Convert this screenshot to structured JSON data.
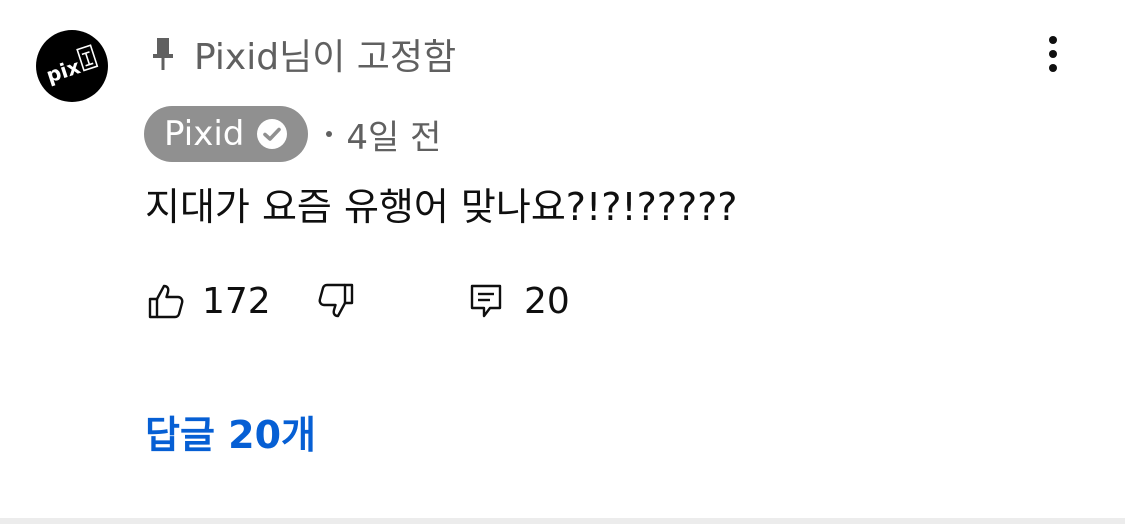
{
  "comment": {
    "pinned_text": "Pixid님이 고정함",
    "author": "Pixid",
    "avatar_text": "pix픽",
    "time_ago": "4일 전",
    "text": "지대가 요즘 유행어 맞나요?!?!?????",
    "likes": "172",
    "replies_count": "20",
    "view_replies_label": "답글 20개",
    "icons": {
      "pin": "pin-icon",
      "verified": "verified-check-icon",
      "more": "more-vertical-icon",
      "like": "thumbs-up-icon",
      "dislike": "thumbs-down-icon",
      "reply": "comment-reply-icon"
    },
    "colors": {
      "author_chip_bg": "#909090",
      "link_blue": "#065fd4",
      "muted_text": "#606060"
    }
  }
}
